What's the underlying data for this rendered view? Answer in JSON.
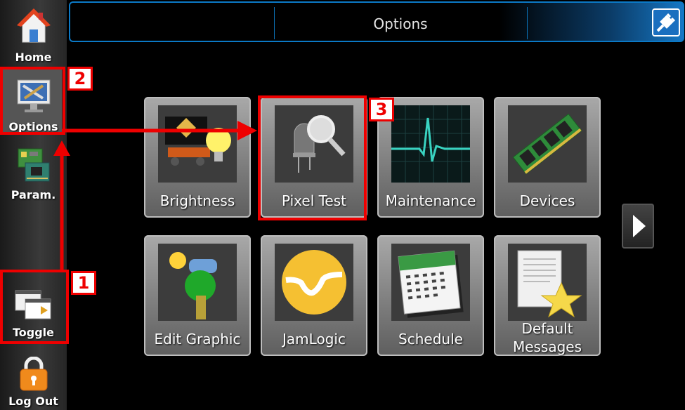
{
  "header": {
    "title": "Options"
  },
  "sidebar": {
    "items": [
      {
        "label": "Home"
      },
      {
        "label": "Options"
      },
      {
        "label": "Param."
      },
      {
        "label": "Toggle"
      },
      {
        "label": "Log Out"
      }
    ]
  },
  "tiles": [
    {
      "label": "Brightness"
    },
    {
      "label": "Pixel Test"
    },
    {
      "label": "Maintenance"
    },
    {
      "label": "Devices"
    },
    {
      "label": "Edit Graphic"
    },
    {
      "label": "JamLogic"
    },
    {
      "label": "Schedule"
    },
    {
      "label": "Default Messages"
    }
  ],
  "annotations": {
    "step1": "1",
    "step2": "2",
    "step3": "3"
  },
  "colors": {
    "accent": "#0b79c6",
    "annotation": "#e00000"
  }
}
